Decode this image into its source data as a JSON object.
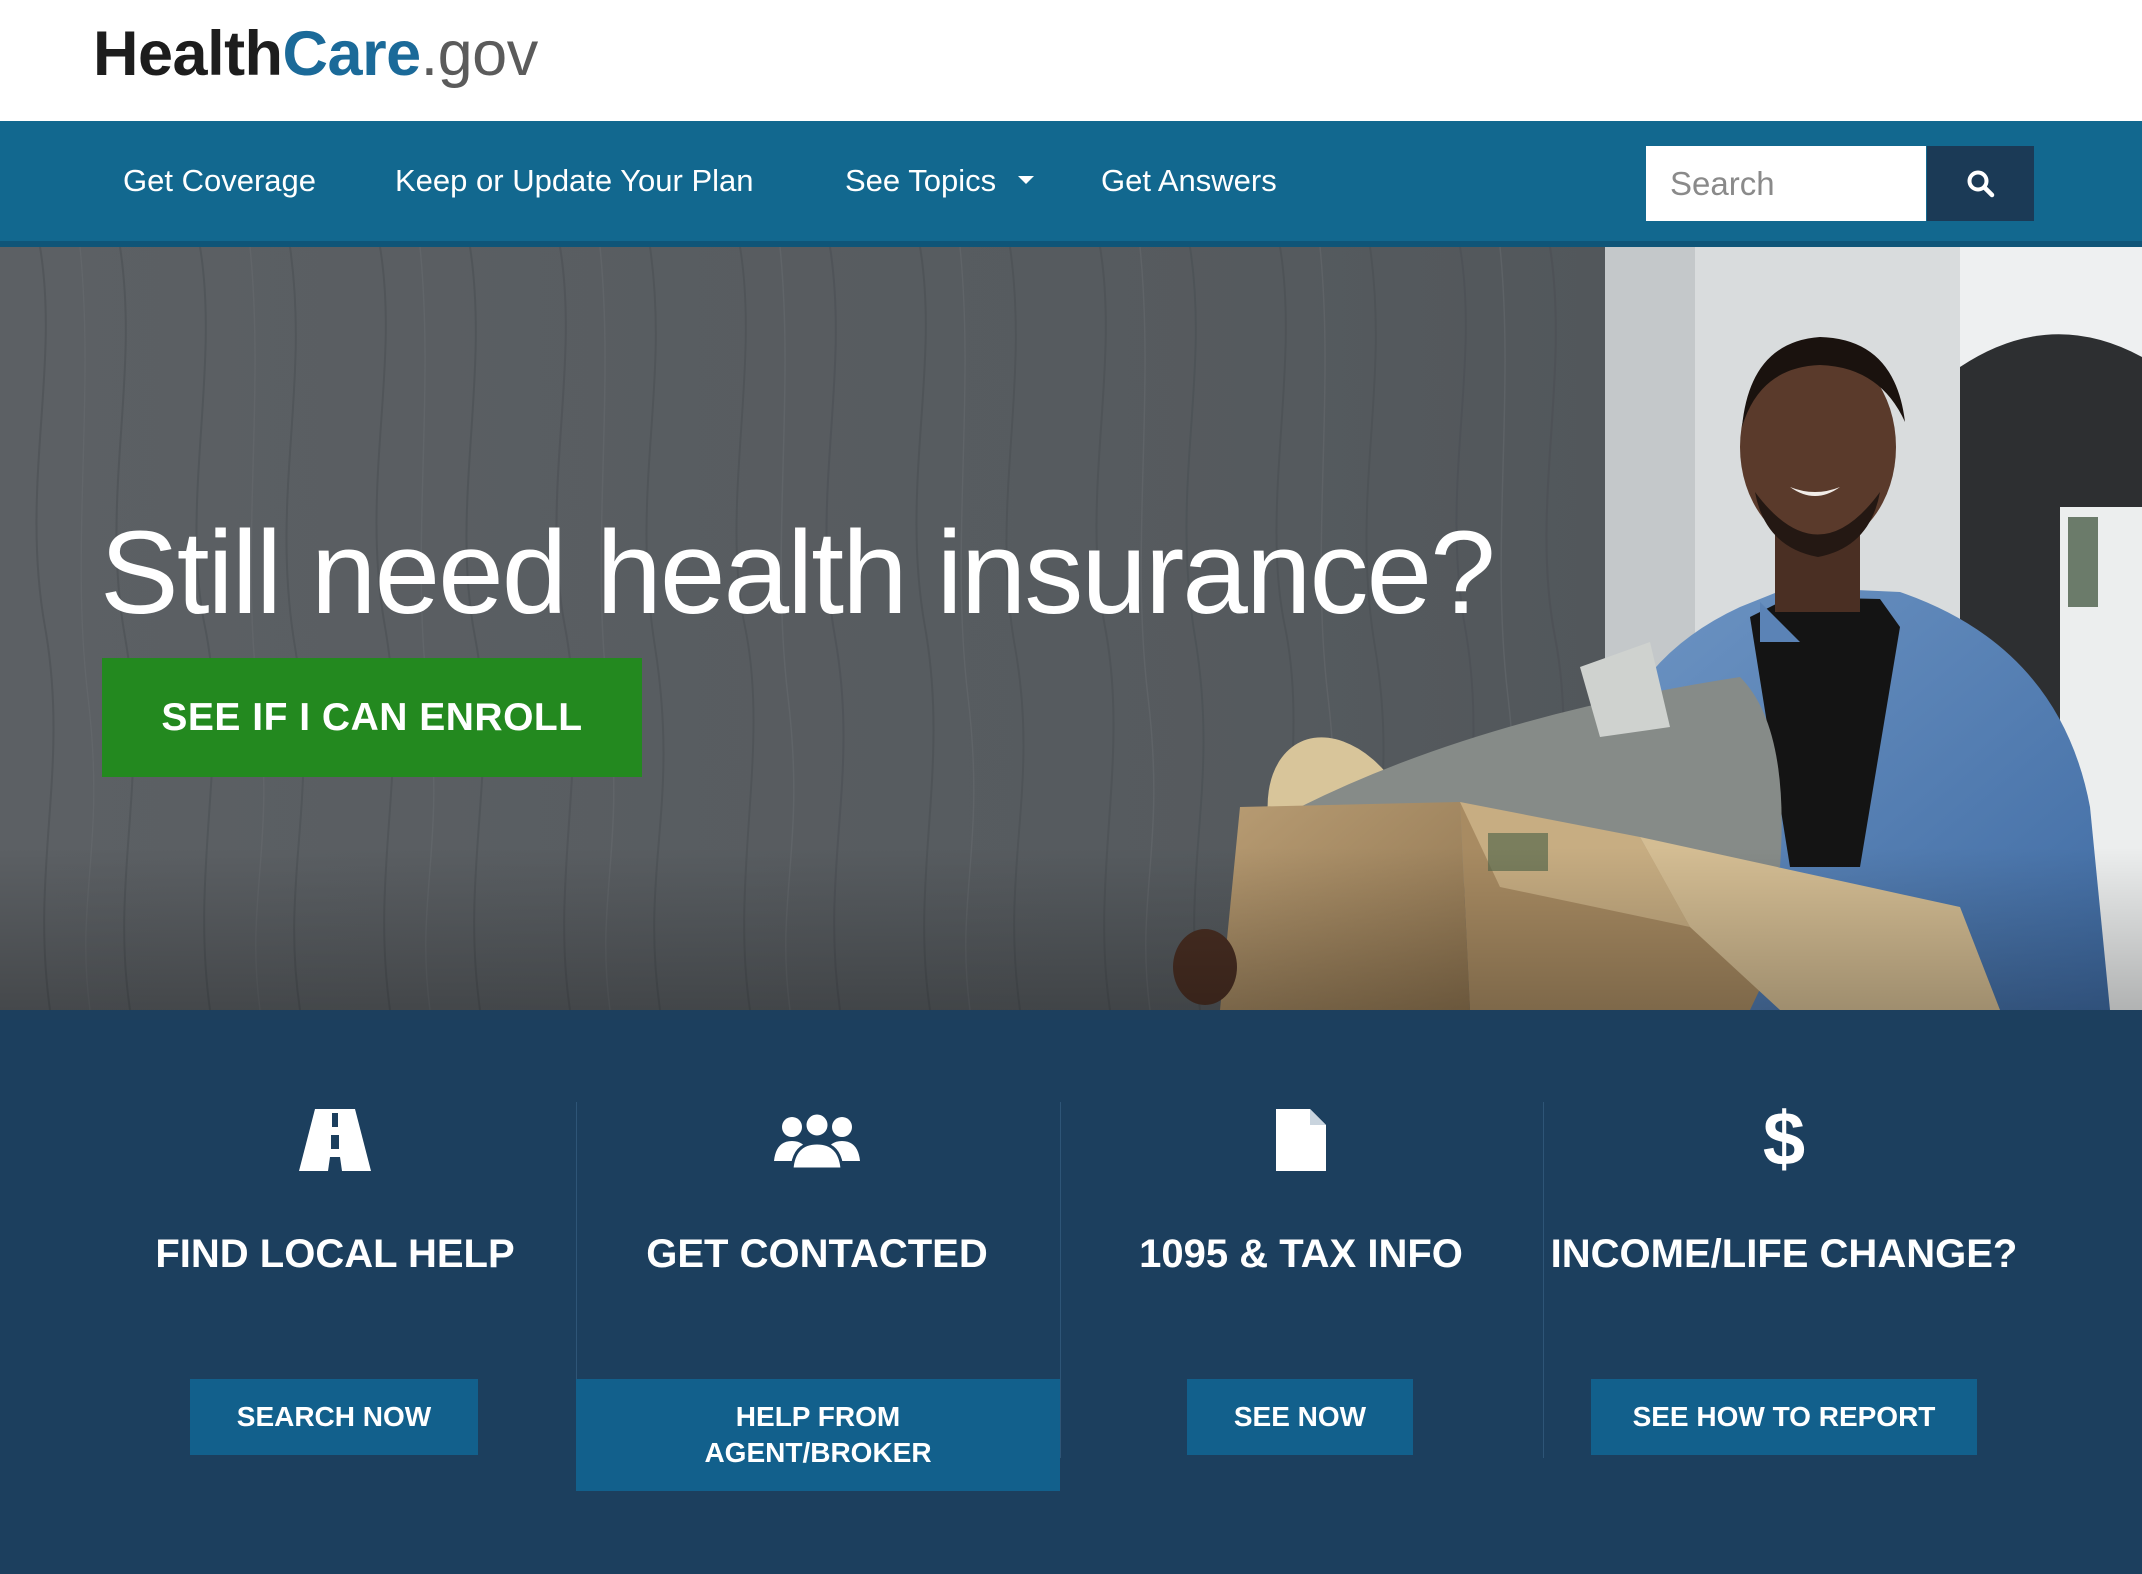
{
  "header": {
    "logo": {
      "part1": "Health",
      "part2": "Care",
      "part3": ".gov"
    }
  },
  "nav": {
    "items": [
      {
        "label": "Get Coverage"
      },
      {
        "label": "Keep or Update Your Plan"
      },
      {
        "label": "See Topics"
      },
      {
        "label": "Get Answers"
      }
    ],
    "search": {
      "placeholder": "Search"
    }
  },
  "hero": {
    "title": "Still need health insurance?",
    "cta_label": "SEE IF I CAN ENROLL"
  },
  "cards": [
    {
      "icon": "road-icon",
      "title": "FIND LOCAL HELP",
      "button": "SEARCH NOW"
    },
    {
      "icon": "people-icon",
      "title": "GET CONTACTED",
      "button": "HELP FROM AGENT/BROKER"
    },
    {
      "icon": "document-icon",
      "title": "1095 & TAX INFO",
      "button": "SEE NOW"
    },
    {
      "icon": "dollar-icon",
      "title": "INCOME/LIFE CHANGE?",
      "button": "SEE HOW TO REPORT"
    }
  ],
  "colors": {
    "brand_blue": "#12688f",
    "dark_navy": "#1c3f5e",
    "cta_green": "#23891f",
    "card_button": "#12608c"
  }
}
